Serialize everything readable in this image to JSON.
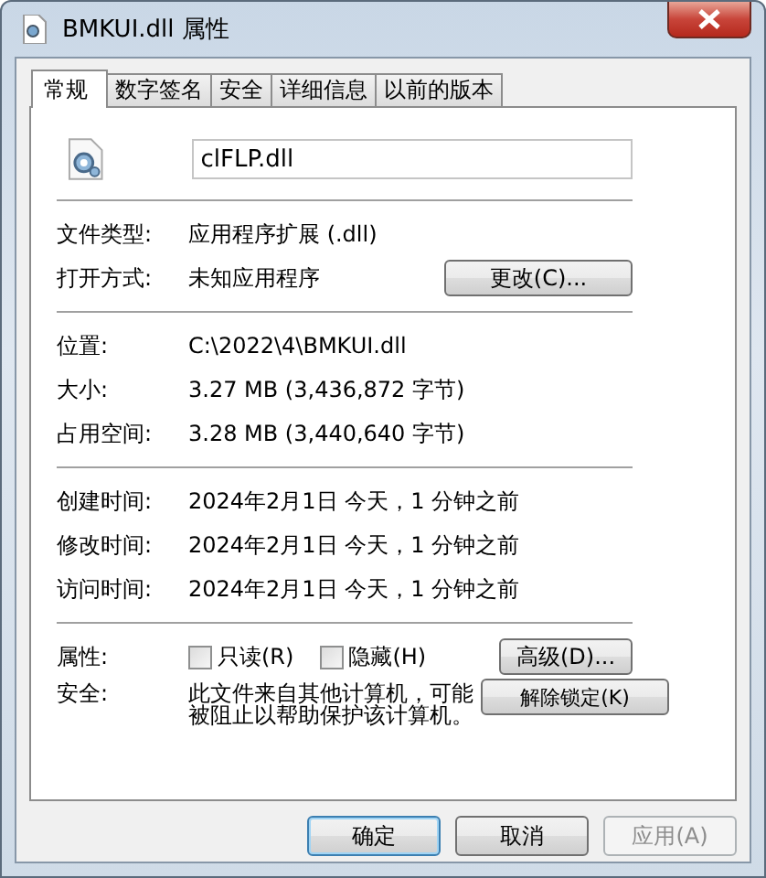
{
  "window": {
    "title": "BMKUI.dll 属性"
  },
  "tabs": [
    {
      "label": "常规",
      "selected": true
    },
    {
      "label": "数字签名",
      "selected": false
    },
    {
      "label": "安全",
      "selected": false
    },
    {
      "label": "详细信息",
      "selected": false
    },
    {
      "label": "以前的版本",
      "selected": false
    }
  ],
  "file_name": "clFLP.dll",
  "sections": [
    {
      "rows": [
        {
          "label": "文件类型:",
          "value": "应用程序扩展 (.dll)"
        },
        {
          "label": "打开方式:",
          "value": "未知应用程序",
          "button": "更改(C)..."
        }
      ]
    },
    {
      "rows": [
        {
          "label": "位置:",
          "value": "C:\\2022\\4\\BMKUI.dll"
        },
        {
          "label": "大小:",
          "value": "3.27 MB (3,436,872 字节)"
        },
        {
          "label": "占用空间:",
          "value": "3.28 MB (3,440,640 字节)"
        }
      ]
    },
    {
      "rows": [
        {
          "label": "创建时间:",
          "value": "2024年2月1日 今天，1 分钟之前"
        },
        {
          "label": "修改时间:",
          "value": "2024年2月1日 今天，1 分钟之前"
        },
        {
          "label": "访问时间:",
          "value": "2024年2月1日 今天，1 分钟之前"
        }
      ]
    }
  ],
  "attributes": {
    "label": "属性:",
    "checkboxes": [
      {
        "label": "只读(R)",
        "checked": false
      },
      {
        "label": "隐藏(H)",
        "checked": false
      }
    ],
    "button": "高级(D)..."
  },
  "security": {
    "label": "安全:",
    "text": "此文件来自其他计算机，可能被阻止以帮助保护该计算机。",
    "button": "解除锁定(K)"
  },
  "buttons": [
    {
      "label": "确定",
      "default": true,
      "disabled": false
    },
    {
      "label": "取消",
      "default": false,
      "disabled": false
    },
    {
      "label": "应用(A)",
      "default": false,
      "disabled": true
    }
  ]
}
